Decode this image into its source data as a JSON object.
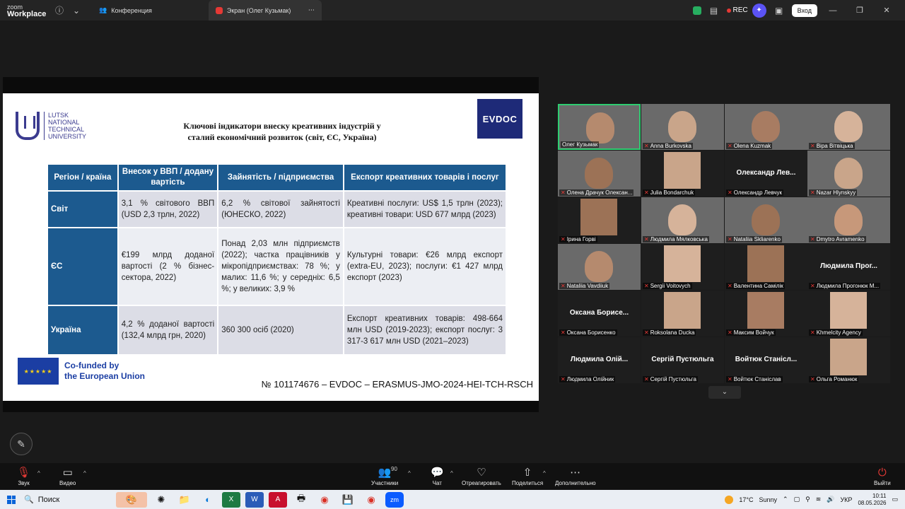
{
  "titlebar": {
    "brand_top": "zoom",
    "brand_bottom": "Workplace",
    "tab_conference": "Конференция",
    "tab_screen": "Экран (Олег Кузьмак)",
    "rec": "REC",
    "login": "Вход"
  },
  "slide": {
    "logo_lines": [
      "LUTSK",
      "NATIONAL",
      "TECHNICAL",
      "UNIVERSITY"
    ],
    "title_line1": "Ключові індикатори внеску креативних індустрій у",
    "title_line2": "сталий економічний розвиток (світ, ЄС, Україна)",
    "evdoc": "EVDOC",
    "headers": [
      "Регіон / країна",
      "Внесок у ВВП / додану вартість",
      "Зайнятість / підприємства",
      "Експорт креативних товарів і послуг"
    ],
    "rows": [
      {
        "region": "Світ",
        "gdp": "3,1 % світового ВВП (USD 2,3 трлн, 2022)",
        "employment": "6,2 % світової зайнятості (ЮНЕСКО, 2022)",
        "export": "Креативні послуги: US$ 1,5 трлн (2023); креативні товари: USD 677 млрд (2023)"
      },
      {
        "region": "ЄС",
        "gdp": "€199 млрд доданої вартості (2 % бізнес-сектора, 2022)",
        "employment": "Понад 2,03 млн підприємств (2022); частка працівників у мікропідприємствах: 78 %; у малих: 11,6 %; у середніх: 6,5 %; у великих: 3,9 %",
        "export": "Культурні товари: €26 млрд експорт (extra-EU, 2023); послуги: €1 427 млрд експорт (2023)"
      },
      {
        "region": "Україна",
        "gdp": "4,2 % доданої вартості (132,4 млрд грн, 2020)",
        "employment": "360 300 осіб (2020)",
        "export": "Експорт креативних товарів: 498-664 млн USD (2019-2023); експорт послуг: 3 317-3 617 млн USD (2021–2023)"
      }
    ],
    "eu_line1": "Co-funded by",
    "eu_line2": "the European Union",
    "project_no": "№ 101174676 – EVDOC – ERASMUS-JMO-2024-HEI-TCH-RSCH"
  },
  "participants": [
    {
      "name": "Олег Кузьмак",
      "mic_off": false,
      "big": "",
      "kind": "video"
    },
    {
      "name": "Anna Burkovska",
      "mic_off": true,
      "big": "",
      "kind": "video"
    },
    {
      "name": "Olena Kuzmak",
      "mic_off": true,
      "big": "",
      "kind": "video"
    },
    {
      "name": "Віра Вітвіцька",
      "mic_off": true,
      "big": "",
      "kind": "video"
    },
    {
      "name": "Олена Драчук Олексан...",
      "mic_off": true,
      "big": "",
      "kind": "video"
    },
    {
      "name": "Julia Bondarchuk",
      "mic_off": true,
      "big": "",
      "kind": "thumb"
    },
    {
      "name": "Олександр Левчук",
      "mic_off": true,
      "big": "Олександр Лев...",
      "kind": "name"
    },
    {
      "name": "Nazar Hlynskyy",
      "mic_off": true,
      "big": "",
      "kind": "video"
    },
    {
      "name": "Ірина Горві",
      "mic_off": true,
      "big": "",
      "kind": "thumb"
    },
    {
      "name": "Людмила Мялковська",
      "mic_off": true,
      "big": "",
      "kind": "video"
    },
    {
      "name": "Nataliia Skliarenko",
      "mic_off": true,
      "big": "",
      "kind": "video"
    },
    {
      "name": "Dmytro Avramenko",
      "mic_off": true,
      "big": "",
      "kind": "video"
    },
    {
      "name": "Nataliia Vavdiiuk",
      "mic_off": true,
      "big": "",
      "kind": "video"
    },
    {
      "name": "Sergii Voitovych",
      "mic_off": true,
      "big": "",
      "kind": "thumb"
    },
    {
      "name": "Валентина Самілік",
      "mic_off": true,
      "big": "",
      "kind": "thumb"
    },
    {
      "name": "Людмила Прогонюк М...",
      "mic_off": true,
      "big": "Людмила Прог...",
      "kind": "name"
    },
    {
      "name": "Оксана Борисенко",
      "mic_off": true,
      "big": "Оксана Борисе...",
      "kind": "name"
    },
    {
      "name": "Roksolana Ducka",
      "mic_off": true,
      "big": "",
      "kind": "thumb"
    },
    {
      "name": "Максим Войчук",
      "mic_off": true,
      "big": "",
      "kind": "thumb"
    },
    {
      "name": "Khmelcity Agency",
      "mic_off": true,
      "big": "",
      "kind": "thumb"
    },
    {
      "name": "Людмила Олійник",
      "mic_off": true,
      "big": "Людмила Олій...",
      "kind": "name"
    },
    {
      "name": "Сергій Пустюльга",
      "mic_off": true,
      "big": "Сергій Пустюльга",
      "kind": "name"
    },
    {
      "name": "Войтюк Станіслав",
      "mic_off": true,
      "big": "Войтюк Станісл...",
      "kind": "name"
    },
    {
      "name": "Ольга Романюк",
      "mic_off": true,
      "big": "",
      "kind": "thumb"
    }
  ],
  "toolbar": {
    "audio": "Звук",
    "video": "Видео",
    "participants": "Участники",
    "participants_count": "90",
    "chat": "Чат",
    "react": "Отреагировать",
    "share": "Поделиться",
    "more": "Дополнительно",
    "leave": "Выйти"
  },
  "taskbar": {
    "search": "Поиск",
    "temp": "17°C",
    "weather": "Sunny",
    "lang": "УКР",
    "time": "10:11",
    "date": "08.05.2026"
  }
}
